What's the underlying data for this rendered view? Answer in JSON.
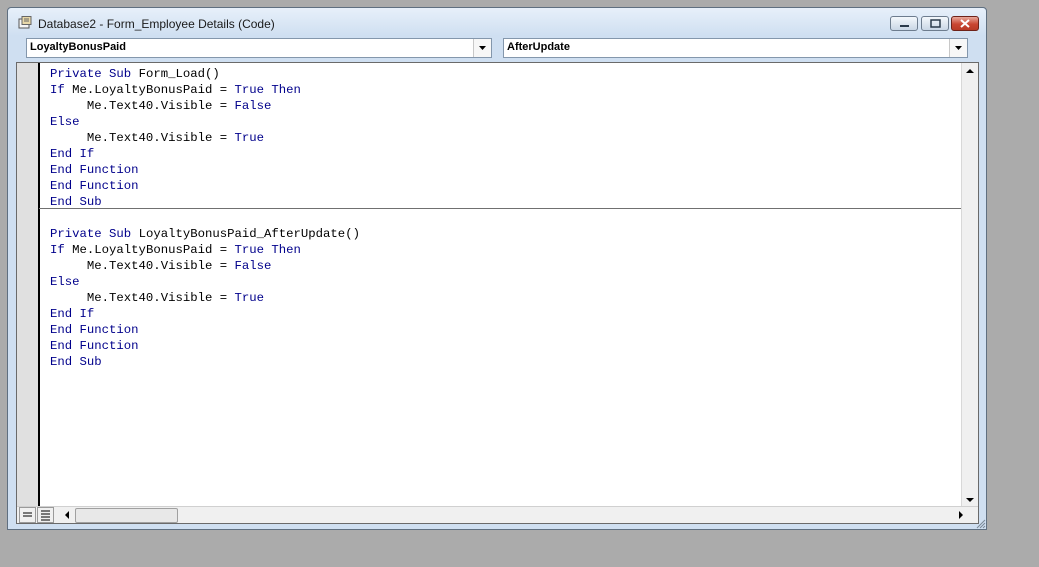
{
  "window": {
    "title": "Database2 - Form_Employee Details (Code)",
    "buttons": [
      "minimize",
      "maximize",
      "close"
    ]
  },
  "object_combo": {
    "value": "LoyaltyBonusPaid"
  },
  "procedure_combo": {
    "value": "AfterUpdate"
  },
  "code": {
    "procedures": [
      {
        "lines": [
          "Private Sub Form_Load()",
          "If Me.LoyaltyBonusPaid = True Then",
          "     Me.Text40.Visible = False",
          "Else",
          "     Me.Text40.Visible = True",
          "End If",
          "End Function",
          "End Function",
          "End Sub"
        ]
      },
      {
        "lines": [
          "Private Sub LoyaltyBonusPaid_AfterUpdate()",
          "If Me.LoyaltyBonusPaid = True Then",
          "     Me.Text40.Visible = False",
          "Else",
          "     Me.Text40.Visible = True",
          "End If",
          "End Function",
          "End Function",
          "End Sub"
        ]
      }
    ]
  },
  "icons": {
    "title": "vba-module-icon",
    "combo_drop": "chevron-down-icon",
    "scroll_up": "arrow-up-icon",
    "scroll_down": "arrow-down-icon",
    "scroll_left": "arrow-left-icon",
    "scroll_right": "arrow-right-icon",
    "procedure_view": "procedure-view-icon",
    "full_module_view": "full-module-view-icon"
  },
  "colors": {
    "keyword": "#00008b",
    "identifier": "#000000",
    "desktop": "#ababab"
  }
}
